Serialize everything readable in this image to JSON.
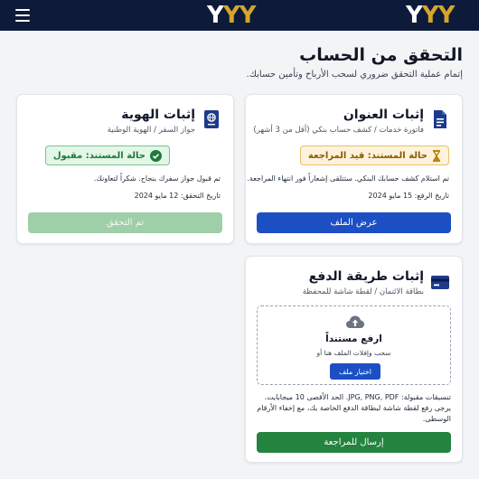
{
  "header": {
    "logo_text": "YYY",
    "logo_left": "Y",
    "logo_rest": "YY"
  },
  "page": {
    "title": "التحقق من الحساب",
    "subtitle": "إتمام عملية التحقق ضروري لسحب الأرباح وتأمين حسابك."
  },
  "cards": {
    "address": {
      "icon": "document-icon",
      "title": "إثبات العنوان",
      "subtitle": "فاتورة خدمات / كشف حساب بنكي (أقل من 3 أشهر)",
      "status": "حالة المستند: قيد المراجعة",
      "note": "تم استلام كشف حسابك البنكي. ستتلقى إشعاراً فور انتهاء المراجعة.",
      "date": "تاريخ الرفع: 15 مايو 2024",
      "button": "عرض الملف"
    },
    "identity": {
      "icon": "passport-icon",
      "title": "إثبات الهوية",
      "subtitle": "جواز السفر / الهوية الوطنية",
      "status": "حالة المستند: مقبول",
      "note": "تم قبول جواز سفرك بنجاح. شكراً لتعاونك.",
      "date": "تاريخ التحقق: 12 مايو 2024",
      "button": "تم التحقق"
    },
    "payment": {
      "icon": "credit-card-icon",
      "title": "إثبات طريقة الدفع",
      "subtitle": "بطاقة الائتمان / لقطة شاشة للمحفظة",
      "upload_title": "ارفع مستنداً",
      "upload_hint": "سحب وإفلات الملف هنا أو",
      "choose_button": "اختيار ملف",
      "formats": "تنسيقات مقبولة: JPG, PNG, PDF. الحد الأقصى 10 ميجابايت.",
      "instructions": "يرجى رفع لقطة شاشة لبطاقة الدفع الخاصة بك، مع إخفاء الأرقام الوسطى.",
      "button": "إرسال للمراجعة"
    }
  },
  "colors": {
    "navy": "#0e1a3a",
    "gold": "#d4a62a",
    "primary": "#1d4fc4",
    "success": "#23833f",
    "pending_bg": "#fdf3dc",
    "accepted_bg": "#e3f6e8"
  }
}
